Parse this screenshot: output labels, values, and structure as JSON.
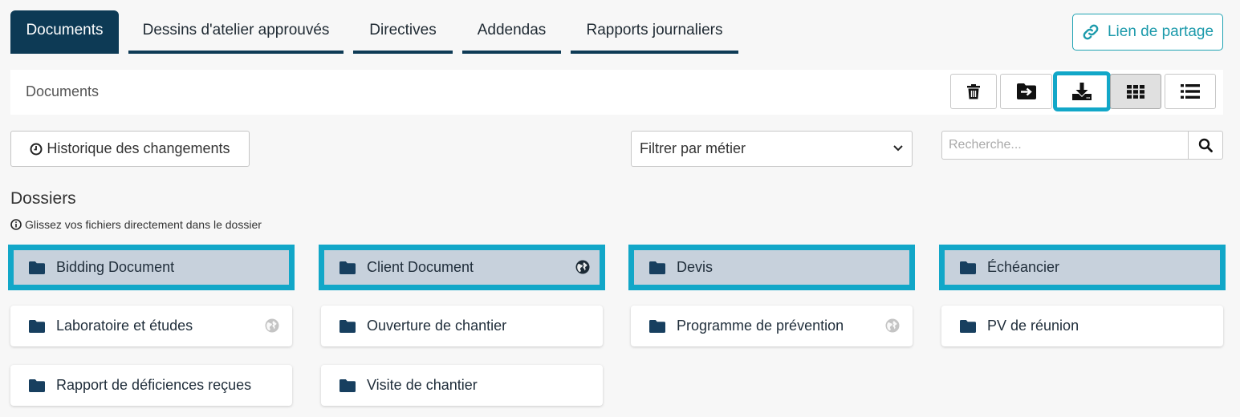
{
  "tabs": [
    {
      "label": "Documents",
      "active": true
    },
    {
      "label": "Dessins d'atelier approuvés",
      "active": false
    },
    {
      "label": "Directives",
      "active": false
    },
    {
      "label": "Addendas",
      "active": false
    },
    {
      "label": "Rapports journaliers",
      "active": false
    }
  ],
  "share_button": {
    "label": "Lien de partage",
    "icon": "link-icon"
  },
  "header": {
    "title": "Documents"
  },
  "toolbar": {
    "delete_icon": "trash-icon",
    "move_icon": "folder-move-icon",
    "download_icon": "download-icon",
    "grid_view_icon": "grid-icon",
    "list_view_icon": "list-icon",
    "active_view": "grid"
  },
  "history_button": {
    "label": "Historique des changements",
    "icon": "clock-icon"
  },
  "filter": {
    "selected": "Filtrer par métier"
  },
  "search": {
    "placeholder": "Recherche..."
  },
  "section": {
    "title": "Dossiers",
    "hint": "Glissez vos fichiers directement dans le dossier"
  },
  "folders": [
    {
      "name": "Bidding Document",
      "selected": true,
      "shared": false
    },
    {
      "name": "Client Document",
      "selected": true,
      "shared": true
    },
    {
      "name": "Devis",
      "selected": true,
      "shared": false
    },
    {
      "name": "Échéancier",
      "selected": true,
      "shared": false
    },
    {
      "name": "Laboratoire et études",
      "selected": false,
      "shared": true
    },
    {
      "name": "Ouverture de chantier",
      "selected": false,
      "shared": false
    },
    {
      "name": "Programme de prévention",
      "selected": false,
      "shared": true
    },
    {
      "name": "PV de réunion",
      "selected": false,
      "shared": false
    },
    {
      "name": "Rapport de déficiences reçues",
      "selected": false,
      "shared": false
    },
    {
      "name": "Visite de chantier",
      "selected": false,
      "shared": false
    }
  ],
  "colors": {
    "primary": "#0d3a55",
    "accent": "#12a7c8",
    "share_text": "#1c9aab",
    "selected_folder_bg": "#c7d1dc"
  }
}
